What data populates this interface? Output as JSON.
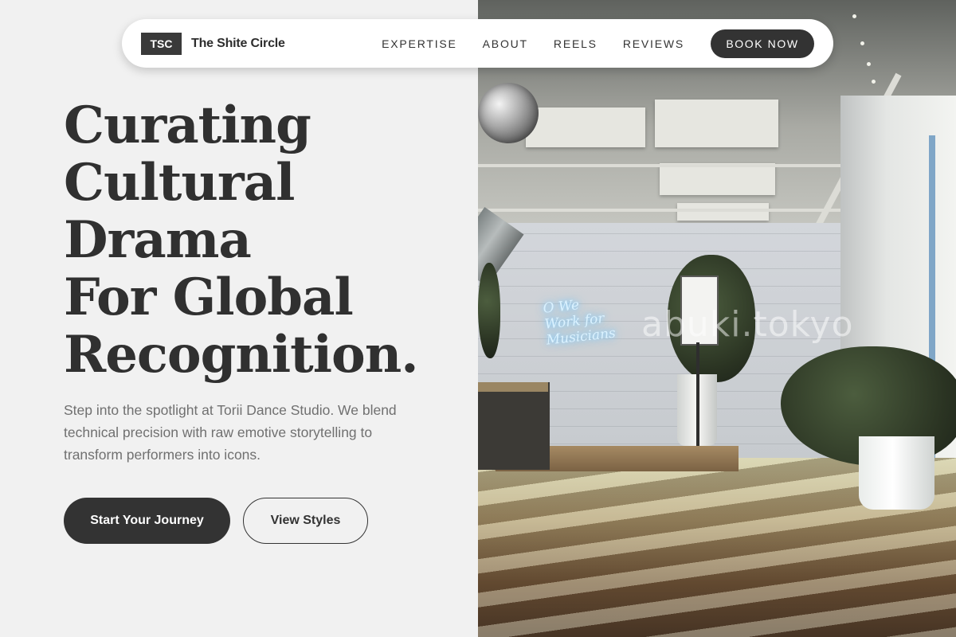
{
  "nav": {
    "badge": "TSC",
    "brand": "The Shite Circle",
    "links": [
      {
        "label": "EXPERTISE"
      },
      {
        "label": "ABOUT"
      },
      {
        "label": "REELS"
      },
      {
        "label": "REVIEWS"
      }
    ],
    "cta": "BOOK NOW"
  },
  "hero": {
    "headline_lines": [
      "Curating",
      "Cultural",
      "Drama",
      "For Global",
      "Recognition."
    ],
    "subtext": "Step into the spotlight at Torii Dance Studio. We blend technical precision with raw emotive storytelling to transform performers into icons.",
    "primary_button": "Start Your Journey",
    "secondary_button": "View Styles"
  },
  "photo": {
    "neon_sign_lines": [
      "O We",
      "Work for",
      "Musicians"
    ],
    "watermark": "abuki.tokyo"
  },
  "colors": {
    "background": "#f1f1f1",
    "dark": "#333333",
    "muted_text": "#707070"
  }
}
